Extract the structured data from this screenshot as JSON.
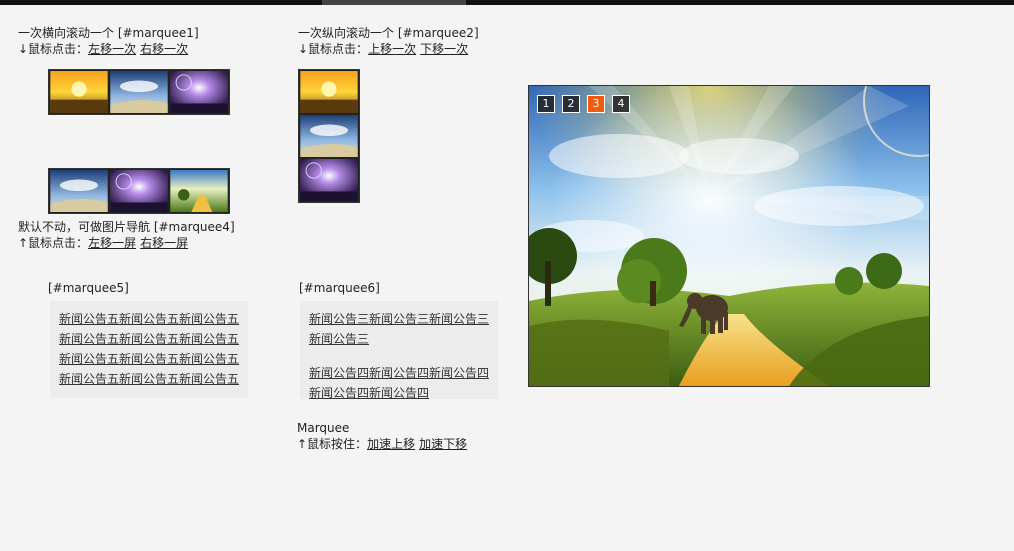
{
  "marquee1": {
    "title": "一次横向滚动一个 [#marquee1]",
    "hint": "↓鼠标点击：",
    "left_label": "左移一次",
    "right_label": "右移一次"
  },
  "marquee2": {
    "title": "一次纵向滚动一个 [#marquee2]",
    "hint": "↓鼠标点击：",
    "up_label": "上移一次",
    "down_label": "下移一次"
  },
  "marquee4": {
    "title": "默认不动，可做图片导航 [#marquee4]",
    "hint": "↑鼠标点击：",
    "left_label": "左移一屏",
    "right_label": "右移一屏"
  },
  "marquee5": {
    "title": "[#marquee5]",
    "items": [
      "新闻公告五新闻公告五新闻公告五",
      "新闻公告五新闻公告五新闻公告五",
      "新闻公告五新闻公告五新闻公告五",
      "新闻公告五新闻公告五新闻公告五"
    ]
  },
  "marquee6": {
    "title": "[#marquee6]",
    "items": [
      "新闻公告三新闻公告三新闻公告三新闻公告三",
      "新闻公告四新闻公告四新闻公告四新闻公告四新闻公告四"
    ]
  },
  "marquee_bottom": {
    "title": "Marquee",
    "hint": "↑鼠标按住：",
    "up_label": "加速上移",
    "down_label": "加速下移"
  },
  "slideshow": {
    "pages": [
      "1",
      "2",
      "3",
      "4"
    ],
    "active_page": "3"
  },
  "colors": {
    "active_page": "#f25b0c",
    "background": "#f4f4f4"
  }
}
